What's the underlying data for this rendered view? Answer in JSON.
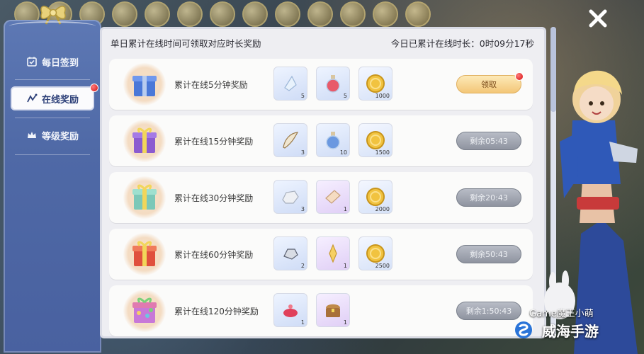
{
  "sidebar": {
    "items": [
      {
        "label": "每日签到",
        "icon": "calendar-check-icon",
        "active": false
      },
      {
        "label": "在线奖励",
        "icon": "online-activity-icon",
        "active": true,
        "badge": true
      },
      {
        "label": "等级奖励",
        "icon": "crown-icon",
        "active": false
      }
    ]
  },
  "panel": {
    "header_title": "单日累计在线时间可领取对应时长奖励",
    "header_status": "今日已累计在线时长：0时09分17秒"
  },
  "rows": [
    {
      "title": "累计在线5分钟奖励",
      "chest": "blue-gift-box-icon",
      "items": [
        {
          "icon": "crystal-shard-icon",
          "qty": "5",
          "tint": "blue"
        },
        {
          "icon": "potion-flask-icon",
          "qty": "5",
          "tint": "blue"
        },
        {
          "icon": "gold-coin-icon",
          "qty": "1000",
          "tint": "gold"
        }
      ],
      "action": {
        "label": "领取",
        "state": "claim",
        "badge": true
      }
    },
    {
      "title": "累计在线15分钟奖励",
      "chest": "purple-gift-box-icon",
      "items": [
        {
          "icon": "wing-feather-icon",
          "qty": "3",
          "tint": "blue"
        },
        {
          "icon": "potion-flask-icon",
          "qty": "10",
          "tint": "blue"
        },
        {
          "icon": "gold-coin-icon",
          "qty": "1500",
          "tint": "gold"
        }
      ],
      "action": {
        "label": "剩余05:43",
        "state": "wait",
        "badge": false
      }
    },
    {
      "title": "累计在线30分钟奖励",
      "chest": "green-gift-box-icon",
      "items": [
        {
          "icon": "stone-ore-icon",
          "qty": "3",
          "tint": "blue"
        },
        {
          "icon": "ticket-scroll-icon",
          "qty": "1",
          "tint": "purple"
        },
        {
          "icon": "gold-coin-icon",
          "qty": "2000",
          "tint": "gold"
        }
      ],
      "action": {
        "label": "剩余20:43",
        "state": "wait",
        "badge": false
      }
    },
    {
      "title": "累计在线60分钟奖励",
      "chest": "red-gift-box-icon",
      "items": [
        {
          "icon": "gem-ore-icon",
          "qty": "2",
          "tint": "blue"
        },
        {
          "icon": "gold-crystal-icon",
          "qty": "1",
          "tint": "purple"
        },
        {
          "icon": "gold-coin-icon",
          "qty": "2500",
          "tint": "gold"
        }
      ],
      "action": {
        "label": "剩余50:43",
        "state": "wait",
        "badge": false
      }
    },
    {
      "title": "累计在线120分钟奖励",
      "chest": "rainbow-gift-box-icon",
      "items": [
        {
          "icon": "red-cake-icon",
          "qty": "1",
          "tint": "blue"
        },
        {
          "icon": "treasure-chest-icon",
          "qty": "1",
          "tint": "purple"
        }
      ],
      "action": {
        "label": "剩余1:50:43",
        "state": "wait",
        "badge": false
      }
    }
  ],
  "watermark": {
    "line1": "Game魔王小萌",
    "line2": "威海手游"
  },
  "colors": {
    "sidebar": "#5470ad",
    "panel_bg": "#eeeef2",
    "claim_button": "#f3c677",
    "wait_button": "#9ea3ae",
    "badge_red": "#d40f0f"
  }
}
